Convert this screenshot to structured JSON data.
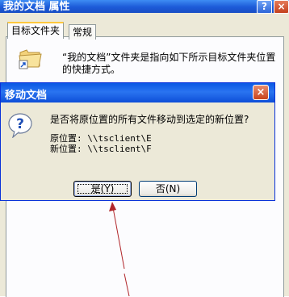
{
  "background_window": {
    "title": "我的文档 属性",
    "help_button": "?",
    "close_button": "×",
    "tabs": [
      {
        "label": "目标文件夹",
        "active": true
      },
      {
        "label": "常规",
        "active": false
      }
    ],
    "description": "“我的文档”文件夹是指向如下所示目标文件夹位置的快捷方式。"
  },
  "dialog": {
    "title": "移动文档",
    "close_button": "×",
    "question": "是否将原位置的所有文件移动到选定的新位置?",
    "original_location": "原位置: \\\\tsclient\\E",
    "new_location": "新位置: \\\\tsclient\\F",
    "yes_button": "是(Y)",
    "no_button": "否(N)"
  },
  "colors": {
    "titlebar_blue": "#0A58E4",
    "dialog_face": "#ECE9D8",
    "arrow_red": "#B0262A"
  },
  "icons": {
    "folder": "folder-shortcut-icon",
    "question": "question-icon"
  }
}
